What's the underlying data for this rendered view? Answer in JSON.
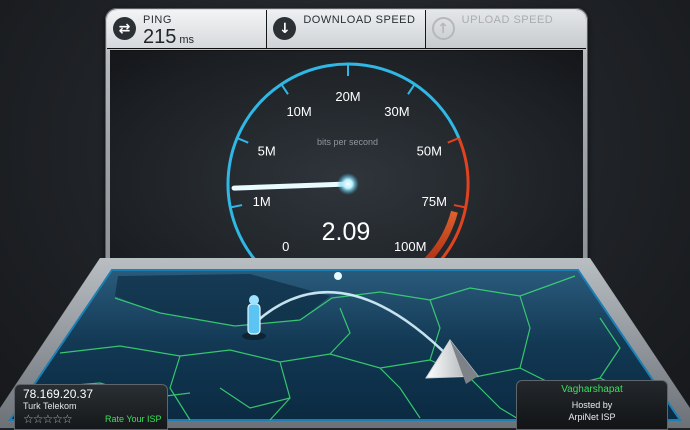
{
  "header": {
    "ping": {
      "label": "PING",
      "value": "215",
      "unit": "ms",
      "icon": "ping-arrows-icon"
    },
    "download": {
      "label": "DOWNLOAD SPEED",
      "icon": "download-arrow-icon"
    },
    "upload": {
      "label": "UPLOAD SPEED",
      "icon": "upload-arrow-icon"
    }
  },
  "gauge": {
    "tick_labels": [
      "0",
      "1M",
      "5M",
      "10M",
      "20M",
      "30M",
      "50M",
      "75M",
      "100M"
    ],
    "units_label": "bits per second",
    "value_display": "2.09",
    "needle_value": 2.09,
    "progress_fraction": 0.5
  },
  "client": {
    "ip": "78.169.20.37",
    "isp": "Turk Telekom",
    "rating_stars": 5,
    "rate_label": "Rate Your ISP"
  },
  "server": {
    "city": "Vagharshapat",
    "hosted_by": "Hosted by",
    "isp": "ArpiNet ISP"
  },
  "colors": {
    "accent_cyan": "#2fb8e6",
    "danger_red": "#e0431f",
    "progress_green": "#3fc450",
    "rate_green": "#35e25a"
  }
}
